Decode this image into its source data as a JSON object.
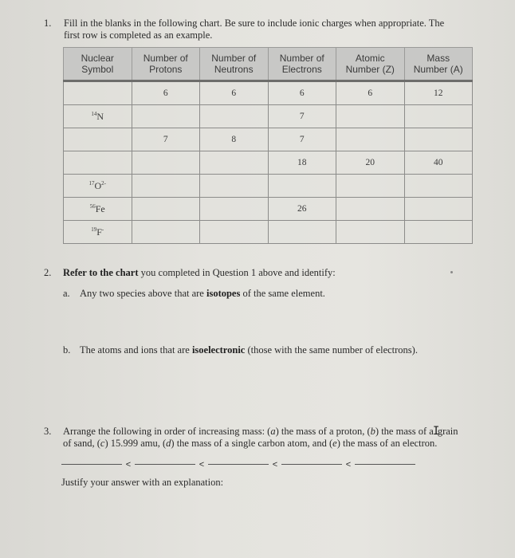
{
  "question1": {
    "number": "1.",
    "line1": "Fill in the blanks in the following chart. Be sure to include ionic charges when appropriate. The",
    "line2": "first row is completed as an example.",
    "table": {
      "headers": [
        [
          "Nuclear",
          "Symbol"
        ],
        [
          "Number of",
          "Protons"
        ],
        [
          "Number of",
          "Neutrons"
        ],
        [
          "Number of",
          "Electrons"
        ],
        [
          "Atomic",
          "Number (Z)"
        ],
        [
          "Mass",
          "Number (A)"
        ]
      ],
      "rows": [
        {
          "symbol_mass": "",
          "symbol_el": "",
          "symbol_charge": "",
          "protons": "6",
          "neutrons": "6",
          "electrons": "6",
          "atomic_number": "6",
          "mass_number": "12"
        },
        {
          "symbol_mass": "14",
          "symbol_el": "N",
          "symbol_charge": "",
          "protons": "",
          "neutrons": "",
          "electrons": "7",
          "atomic_number": "",
          "mass_number": ""
        },
        {
          "symbol_mass": "",
          "symbol_el": "",
          "symbol_charge": "",
          "protons": "7",
          "neutrons": "8",
          "electrons": "7",
          "atomic_number": "",
          "mass_number": ""
        },
        {
          "symbol_mass": "",
          "symbol_el": "",
          "symbol_charge": "",
          "protons": "",
          "neutrons": "",
          "electrons": "18",
          "atomic_number": "20",
          "mass_number": "40"
        },
        {
          "symbol_mass": "17",
          "symbol_el": "O",
          "symbol_charge": "2-",
          "protons": "",
          "neutrons": "",
          "electrons": "",
          "atomic_number": "",
          "mass_number": ""
        },
        {
          "symbol_mass": "56",
          "symbol_el": "Fe",
          "symbol_charge": "",
          "protons": "",
          "neutrons": "",
          "electrons": "26",
          "atomic_number": "",
          "mass_number": ""
        },
        {
          "symbol_mass": "19",
          "symbol_el": "F",
          "symbol_charge": "-",
          "protons": "",
          "neutrons": "",
          "electrons": "",
          "atomic_number": "",
          "mass_number": ""
        }
      ]
    }
  },
  "question2": {
    "number": "2.",
    "intro_bold": "Refer to the chart",
    "intro_rest": " you completed in Question 1 above and identify:",
    "a": {
      "label": "a.",
      "pre": "Any two species above that are ",
      "bold": "isotopes",
      "post": " of the same element."
    },
    "b": {
      "label": "b.",
      "pre": "The atoms and ions that are ",
      "bold": "isoelectronic",
      "post": " (those with the same number of electrons)."
    }
  },
  "question3": {
    "number": "3.",
    "line1_a": "Arrange the following in order of increasing mass: (",
    "a": "a",
    "line1_b": ") the mass of a proton, (",
    "b": "b",
    "line1_c": ") the mass of a",
    "line1_d": "grain",
    "line2_a": "of sand, (",
    "c": "c",
    "line2_b": ") 15.999 amu, (",
    "d": "d",
    "line2_c": ") the mass of a single carbon atom, and (",
    "e": "e",
    "line2_d": ") the mass of an electron.",
    "comparator": "<",
    "justify": "Justify your answer with an explanation:"
  }
}
